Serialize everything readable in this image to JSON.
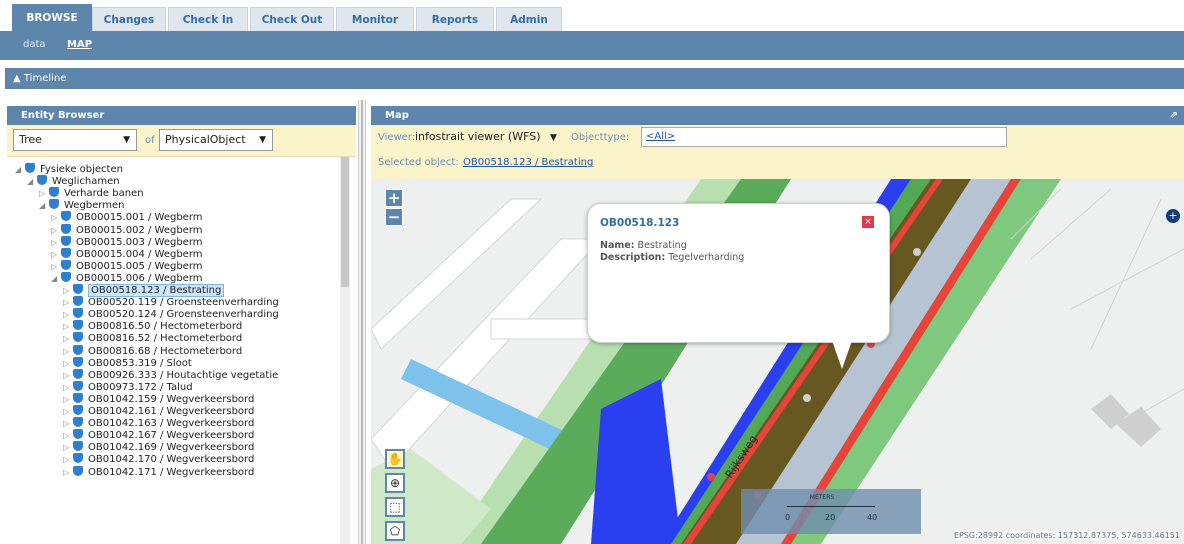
{
  "tabs": [
    {
      "label": "BROWSE",
      "active": true
    },
    {
      "label": "Changes"
    },
    {
      "label": "Check In"
    },
    {
      "label": "Check Out"
    },
    {
      "label": "Monitor"
    },
    {
      "label": "Reports"
    },
    {
      "label": "Admin"
    }
  ],
  "subnav": {
    "data": "data",
    "map": "MAP"
  },
  "timeline": {
    "label": "▲ Timeline"
  },
  "entity_browser": {
    "title": "Entity Browser",
    "view_select": "Tree",
    "of_label": "of",
    "type_select": "PhysicalObject",
    "tree": [
      {
        "label": "Fysieke objecten",
        "level": 0,
        "state": "open"
      },
      {
        "label": "Weglichamen",
        "level": 1,
        "state": "open"
      },
      {
        "label": "Verharde banen",
        "level": 2,
        "state": "closed"
      },
      {
        "label": "Wegbermen",
        "level": 2,
        "state": "open"
      },
      {
        "label": "OB00015.001 / Wegberm",
        "level": 3,
        "state": "closed"
      },
      {
        "label": "OB00015.002 / Wegberm",
        "level": 3,
        "state": "closed"
      },
      {
        "label": "OB00015.003 / Wegberm",
        "level": 3,
        "state": "closed"
      },
      {
        "label": "OB00015.004 / Wegberm",
        "level": 3,
        "state": "closed"
      },
      {
        "label": "OB00015.005 / Wegberm",
        "level": 3,
        "state": "closed"
      },
      {
        "label": "OB00015.006 / Wegberm",
        "level": 3,
        "state": "open"
      },
      {
        "label": "OB00518.123 / Bestrating",
        "level": 4,
        "state": "closed",
        "selected": true
      },
      {
        "label": "OB00520.119 / Groensteenverharding",
        "level": 4,
        "state": "closed"
      },
      {
        "label": "OB00520.124 / Groensteenverharding",
        "level": 4,
        "state": "closed"
      },
      {
        "label": "OB00816.50 / Hectometerbord",
        "level": 4,
        "state": "closed"
      },
      {
        "label": "OB00816.52 / Hectometerbord",
        "level": 4,
        "state": "closed"
      },
      {
        "label": "OB00816.68 / Hectometerbord",
        "level": 4,
        "state": "closed"
      },
      {
        "label": "OB00853.319 / Sloot",
        "level": 4,
        "state": "closed"
      },
      {
        "label": "OB00926.333 / Houtachtige vegetatie",
        "level": 4,
        "state": "closed"
      },
      {
        "label": "OB00973.172 / Talud",
        "level": 4,
        "state": "closed"
      },
      {
        "label": "OB01042.159 / Wegverkeersbord",
        "level": 4,
        "state": "closed"
      },
      {
        "label": "OB01042.161 / Wegverkeersbord",
        "level": 4,
        "state": "closed"
      },
      {
        "label": "OB01042.163 / Wegverkeersbord",
        "level": 4,
        "state": "closed"
      },
      {
        "label": "OB01042.167 / Wegverkeersbord",
        "level": 4,
        "state": "closed"
      },
      {
        "label": "OB01042.169 / Wegverkeersbord",
        "level": 4,
        "state": "closed"
      },
      {
        "label": "OB01042.170 / Wegverkeersbord",
        "level": 4,
        "state": "closed"
      },
      {
        "label": "OB01042.171 / Wegverkeersbord",
        "level": 4,
        "state": "closed"
      }
    ]
  },
  "map_panel": {
    "title": "Map",
    "viewer_label": "Viewer:",
    "viewer_value": "infostrait viewer (WFS)",
    "objecttype_label": "Objecttype:",
    "objecttype_value": "<All>",
    "selected_label": "Selected object:",
    "selected_value": "OB00518.123 / Bestrating",
    "popup": {
      "title": "OB00518.123",
      "name_label": "Name:",
      "name_value": "Bestrating",
      "desc_label": "Description:",
      "desc_value": "Tegelverharding"
    },
    "road_label": "Rijksweg",
    "scale": {
      "unit": "METERS",
      "ticks": [
        "0",
        "20",
        "40"
      ]
    },
    "coords": "EPSG:28992 coordinates: 157312.87375, 574633.46151"
  },
  "colors": {
    "header": "#5e86ac",
    "toolbar_bg": "#fbf3c9",
    "link": "#2f6da3",
    "shield": "#2f7fd0"
  }
}
